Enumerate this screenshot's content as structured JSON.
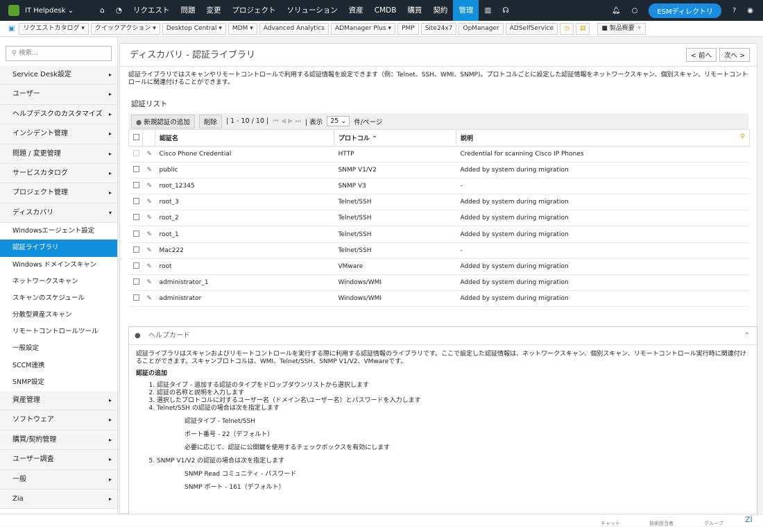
{
  "topbar": {
    "app": "IT Helpdesk",
    "nav": [
      "リクエスト",
      "問題",
      "変更",
      "プロジェクト",
      "ソリューション",
      "資産",
      "CMDB",
      "購買",
      "契約",
      "管理"
    ],
    "esm": "ESMディレクトリ"
  },
  "toolbar": [
    "リクエストカタログ ▾",
    "クイックアクション ▾",
    "Desktop Central ▾",
    "MDM ▾",
    "Advanced Analytics",
    "ADManager Plus ▾",
    "PMP",
    "Site24x7",
    "OpManager",
    "ADSelfService",
    "製品概要"
  ],
  "sidebar": {
    "search": "検索...",
    "top": [
      "Service Desk設定",
      "ユーザー",
      "ヘルプデスクのカスタマイズ",
      "インシデント管理",
      "問題 / 変更管理",
      "サービスカタログ",
      "プロジェクト管理",
      "ディスカバリ"
    ],
    "sub": [
      "Windowsエージェント設定",
      "認証ライブラリ",
      "Windows ドメインスキャン",
      "ネットワークスキャン",
      "スキャンのスケジュール",
      "分散型資産スキャン",
      "リモートコントロールツール",
      "一般設定",
      "SCCM連携",
      "SNMP設定"
    ],
    "bottom": [
      "資産管理",
      "ソフトウェア",
      "購買/契約管理",
      "ユーザー調査",
      "一般",
      "Zia"
    ]
  },
  "main": {
    "title": "ディスカバリ - 認証ライブラリ",
    "prev": "< 前へ",
    "next": "次へ >",
    "desc": "認証ライブラリではスキャンやリモートコントロールで利用する認証情報を設定できます（例：Telnet、SSH、WMI、SNMP)。プロトコルごとに設定した認証情報をネットワークスキャン、個別スキャン、リモートコントロールに関連付けることができます。",
    "list_title": "認証リスト",
    "add": "新規認証の追加",
    "delete": "削除",
    "range": "| 1 - 10 / 10 |",
    "show": "| 表示",
    "per_page": "25",
    "per_label": "件/ページ",
    "columns": [
      "認証名",
      "プロトコル",
      "説明"
    ],
    "rows": [
      {
        "name": "Cisco Phone Credential",
        "protocol": "HTTP",
        "desc": "Credential for scanning Cisco IP Phones"
      },
      {
        "name": "public",
        "protocol": "SNMP V1/V2",
        "desc": "Added by system during migration"
      },
      {
        "name": "root_12345",
        "protocol": "SNMP V3",
        "desc": "-"
      },
      {
        "name": "root_3",
        "protocol": "Telnet/SSH",
        "desc": "Added by system during migration"
      },
      {
        "name": "root_2",
        "protocol": "Telnet/SSH",
        "desc": "Added by system during migration"
      },
      {
        "name": "root_1",
        "protocol": "Telnet/SSH",
        "desc": "Added by system during migration"
      },
      {
        "name": "Mac222",
        "protocol": "Telnet/SSH",
        "desc": "-"
      },
      {
        "name": "root",
        "protocol": "VMware",
        "desc": "Added by system during migration"
      },
      {
        "name": "administrator_1",
        "protocol": "Windows/WMI",
        "desc": "Added by system during migration"
      },
      {
        "name": "administrator",
        "protocol": "Windows/WMI",
        "desc": "Added by system during migration"
      }
    ]
  },
  "help": {
    "title": "ヘルプカード",
    "intro": "認証ライブラリはスキャンおよびリモートコントロールを実行する際に利用する認証情報のライブラリです。ここで設定した認証情報は、ネットワークスキャン、個別スキャン、リモートコントロール実行時に関連付けることができます。スキャンプロトコルは、WMI、Telnet/SSH、SNMP V1/V2、VMwareです。",
    "heading": "認証の追加",
    "steps": [
      "認証タイプ - 追加する認証のタイプをドロップダウンリストから選択します",
      "認証の名称と説明を入力します",
      "選択したプロトコルに対するユーザー名（ドメイン名\\ユーザー名）とパスワードを入力します",
      "Telnet/SSH の認証の場合は次を指定します"
    ],
    "telnet": [
      "認証タイプ - Telnet/SSH",
      "ポート番号 - 22（デフォルト）",
      "必要に応じて、認証に公開鍵を使用するチェックボックスを有効にします"
    ],
    "step5": "SNMP V1/V2 の認証の場合は次を指定します",
    "snmp": [
      "SNMP Read コミュニティ - パスワード",
      "SNMP ポート - 161（デフォルト）"
    ]
  },
  "bottom": [
    "チャット",
    "技術担当者",
    "グループ"
  ]
}
